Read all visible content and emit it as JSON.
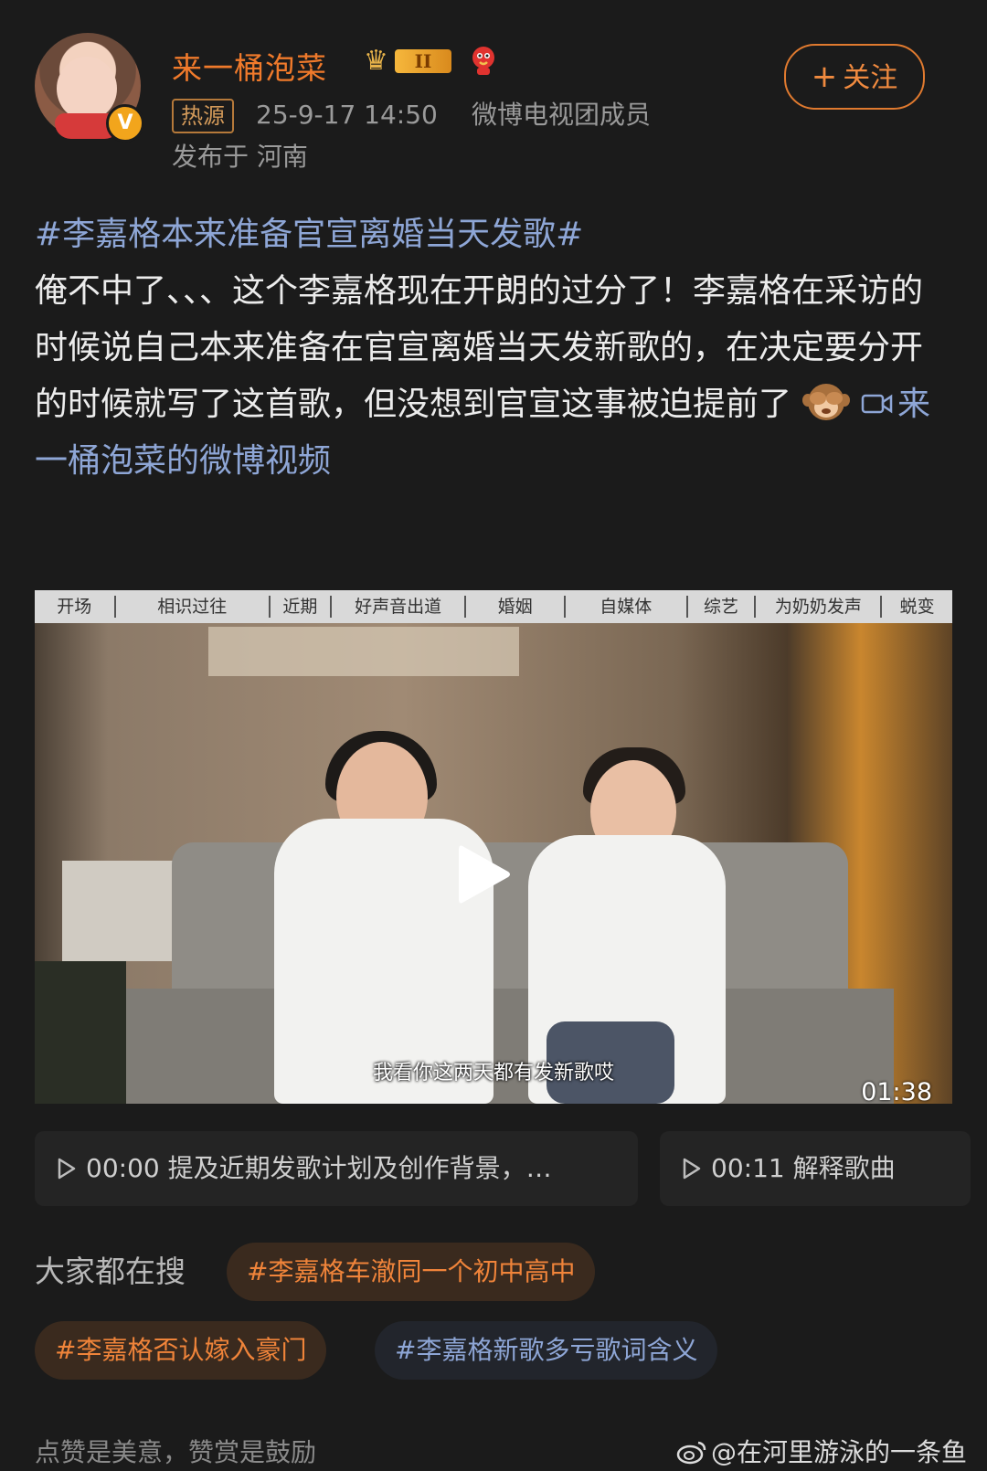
{
  "post": {
    "username": "来一桶泡菜",
    "level_badge": "II",
    "source_tag": "热源",
    "timestamp": "25-9-17 14:50",
    "group": "微博电视团成员",
    "location": "发布于 河南",
    "follow_label": "关注",
    "verified_mark": "V",
    "hashtag": "#李嘉格本来准备官宣离婚当天发歌#",
    "body": "俺不中了、、、这个李嘉格现在开朗的过分了！李嘉格在采访的时候说自己本来准备在官宣离婚当天发新歌的，在决定要分开的时候就写了这首歌，但没想到官宣这事被迫提前了",
    "video_link": "来一桶泡菜的微博视频",
    "emoji": "see-no-evil-monkey"
  },
  "video": {
    "chapters": [
      "开场",
      "相识过往",
      "近期",
      "好声音出道",
      "婚姻",
      "自媒体",
      "综艺",
      "为奶奶发声",
      "蜕变"
    ],
    "subtitle": "我看你这两天都有发新歌哎",
    "duration": "01:38"
  },
  "timeline": [
    {
      "time": "00:00",
      "text": "提及近期发歌计划及创作背景，…"
    },
    {
      "time": "00:11",
      "text": "解释歌曲"
    }
  ],
  "search": {
    "label": "大家都在搜",
    "topics": [
      {
        "text": "#李嘉格车澈同一个初中高中",
        "style": "hot"
      },
      {
        "text": "#李嘉格否认嫁入豪门",
        "style": "hot"
      },
      {
        "text": "#李嘉格新歌多亏歌词含义",
        "style": "cool"
      }
    ]
  },
  "footer": {
    "note": "点赞是美意，赞赏是鼓励",
    "watermark": "@在河里游泳的一条鱼"
  },
  "colors": {
    "background": "#1b1b1b",
    "username": "#f07a2b",
    "link": "#8ea6d6",
    "follow": "#f08a3f"
  }
}
